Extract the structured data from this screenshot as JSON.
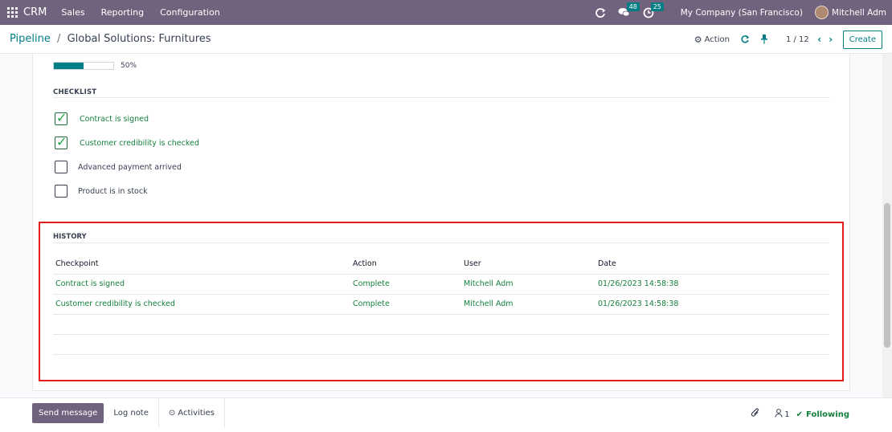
{
  "navbar": {
    "brand": "CRM",
    "menu": [
      "Sales",
      "Reporting",
      "Configuration"
    ],
    "messages_count": "48",
    "activities_count": "25",
    "company": "My Company (San Francisco)",
    "user": "Mitchell Adm"
  },
  "control_panel": {
    "breadcrumb_parent": "Pipeline",
    "breadcrumb_separator": "/",
    "breadcrumb_current": "Global Solutions: Furnitures",
    "action_label": "Action",
    "pager": "1 / 12",
    "create_label": "Create"
  },
  "progress": {
    "value": 0.5,
    "label": "50%"
  },
  "checklist": {
    "title": "CHECKLIST",
    "items": [
      {
        "label": "Contract is signed",
        "checked": true
      },
      {
        "label": "Customer credibility is checked",
        "checked": true
      },
      {
        "label": "Advanced payment arrived",
        "checked": false
      },
      {
        "label": "Product is in stock",
        "checked": false
      }
    ]
  },
  "history": {
    "title": "HISTORY",
    "columns": [
      "Checkpoint",
      "Action",
      "User",
      "Date"
    ],
    "rows": [
      [
        "Contract is signed",
        "Complete",
        "Mitchell Adm",
        "01/26/2023 14:58:38"
      ],
      [
        "Customer credibility is checked",
        "Complete",
        "Mitchell Adm",
        "01/26/2023 14:58:38"
      ]
    ]
  },
  "chatter": {
    "send_message": "Send message",
    "log_note": "Log note",
    "activities": "Activities",
    "followers_count": "1",
    "following": "Following"
  },
  "colors": {
    "navbar": "#71637e",
    "accent": "#017e84",
    "done_text": "#15803d",
    "highlight_border": "#e11d1d"
  }
}
